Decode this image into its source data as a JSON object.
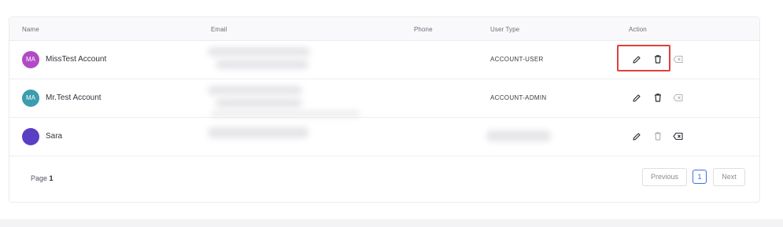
{
  "table": {
    "headers": {
      "name": "Name",
      "email": "Email",
      "phone": "Phone",
      "user_type": "User Type",
      "action": "Action"
    },
    "rows": [
      {
        "initials": "MA",
        "name": "MissTest Account",
        "user_type": "ACCOUNT-USER",
        "avatar_color": "#b24ac6"
      },
      {
        "initials": "MA",
        "name": "Mr.Test Account",
        "user_type": "ACCOUNT-ADMIN",
        "avatar_color": "#3b9dae"
      },
      {
        "initials": "",
        "name": "Sara",
        "user_type": "",
        "avatar_color": "#5a3fc4"
      }
    ],
    "actions": [
      "pencil-icon",
      "trash-icon",
      "clear-icon"
    ]
  },
  "pagination": {
    "page_label": "Page",
    "current_page": "1",
    "previous": "Previous",
    "next": "Next",
    "active_color": "#3f6fe0"
  },
  "highlight_color": "#e0403e"
}
